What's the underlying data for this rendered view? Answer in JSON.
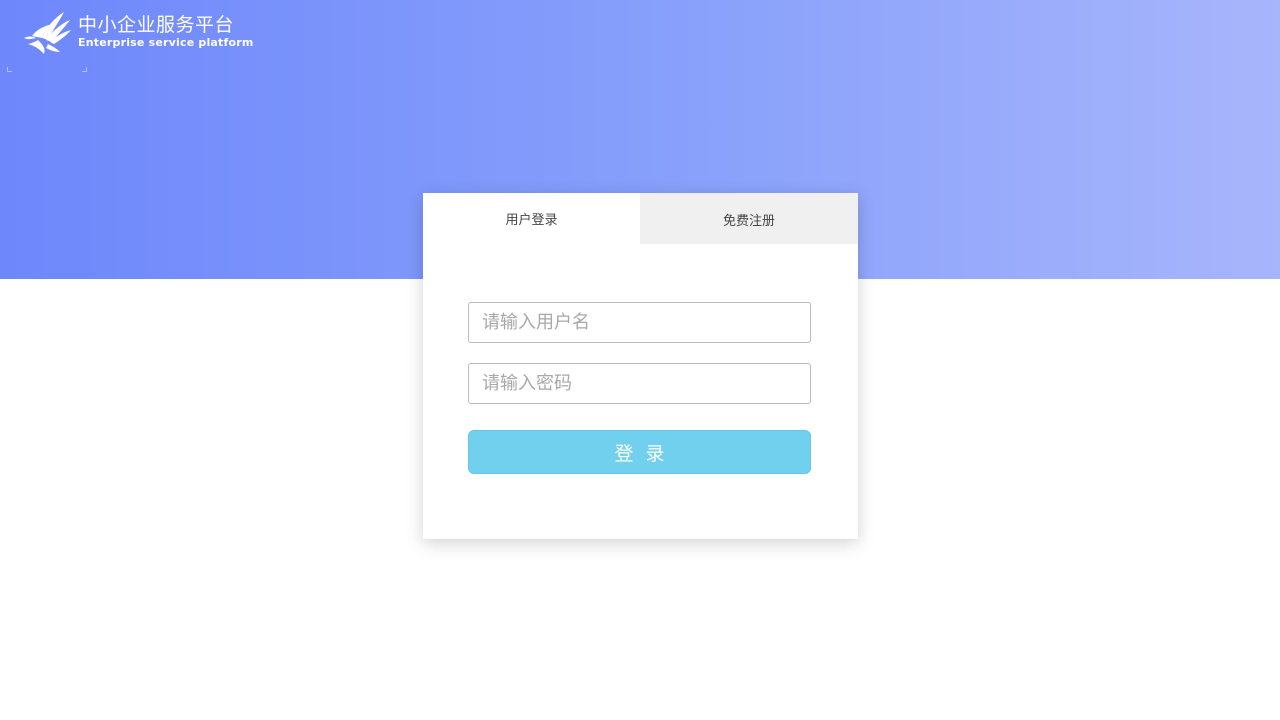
{
  "brand": {
    "logo_icon": "bird-hand-logo-icon",
    "name_cn": "中小企业服务平台",
    "name_en": "Enterprise service platform"
  },
  "login_card": {
    "tabs": [
      {
        "label": "用户登录",
        "active": true
      },
      {
        "label": "免费注册",
        "active": false
      }
    ],
    "username": {
      "value": "",
      "placeholder": "请输入用户名"
    },
    "password": {
      "value": "",
      "placeholder": "请输入密码"
    },
    "submit_label": "登录"
  },
  "colors": {
    "banner_start": "#6e87fb",
    "banner_end": "#a7b5fb",
    "button": "#72d0ef",
    "tab_inactive": "#f0f0f0"
  }
}
